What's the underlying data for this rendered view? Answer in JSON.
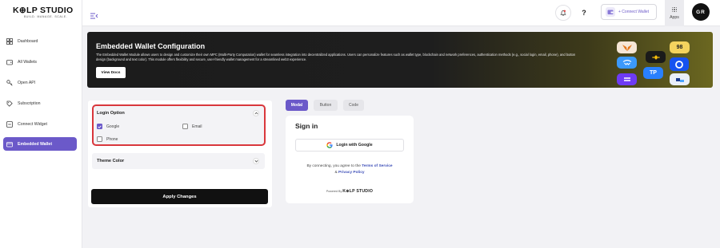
{
  "brand": {
    "name": "K⊕LP STUDIO",
    "tagline": "BUILD. MANAGE. SCALE."
  },
  "sidebar": {
    "items": [
      {
        "label": "Dashboard",
        "icon": "grid-icon"
      },
      {
        "label": "All Wallets",
        "icon": "wallet-icon"
      },
      {
        "label": "Open API",
        "icon": "key-icon"
      },
      {
        "label": "Subscription",
        "icon": "subscription-icon"
      },
      {
        "label": "Connect Widget",
        "icon": "widget-icon"
      },
      {
        "label": "Embedded Wallet",
        "icon": "embedded-wallet-icon",
        "active": true
      }
    ]
  },
  "topbar": {
    "connect_wallet_label": "+ Connect Wallet",
    "apps_label": "Apps",
    "help_label": "?",
    "avatar_initials": "GR"
  },
  "banner": {
    "title": "Embedded Wallet Configuration",
    "description": "The Embedded Wallet Module allows users to design and customize their own MPC (Multi-Party Computation) wallet for seamless integration into decentralized applications. Users can personalize features such as wallet type, blockchain and network preferences, authentication methods (e.g., social login, email, phone), and button design (background and text color). This module offers flexibility and secure, user-friendly wallet management for a streamlined web3 experience.",
    "button_label": "View Docs",
    "tile_text": [
      "98",
      "TP"
    ]
  },
  "config": {
    "login_section_title": "Login Option",
    "options": [
      {
        "label": "Google",
        "checked": true
      },
      {
        "label": "Email",
        "checked": false
      },
      {
        "label": "Phone",
        "checked": false
      }
    ],
    "theme_section_title": "Theme Color",
    "apply_label": "Apply Changes"
  },
  "preview": {
    "tabs": [
      {
        "label": "Modal",
        "active": true
      },
      {
        "label": "Button",
        "active": false
      },
      {
        "label": "Code",
        "active": false
      }
    ],
    "title": "Sign in",
    "google_button_label": "Login with Google",
    "terms_prefix": "By connecting, you agree to the",
    "terms_link": "Terms of Service",
    "terms_and": "&",
    "privacy_link": "Privacy Policy",
    "powered_prefix": "Powered By",
    "powered_brand": "K⊕LP STUDIO"
  },
  "colors": {
    "accent": "#6b59c9",
    "highlight": "#d9373c",
    "dark": "#111111"
  }
}
